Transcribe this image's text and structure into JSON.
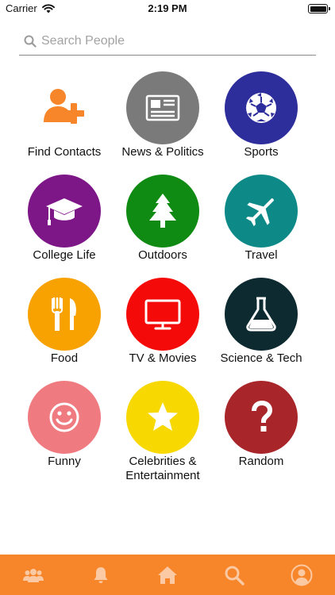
{
  "status_bar": {
    "carrier": "Carrier",
    "time": "2:19 PM",
    "icons": [
      "wifi-icon",
      "battery-icon"
    ]
  },
  "search": {
    "placeholder": "Search People",
    "value": "",
    "icon": "search-icon"
  },
  "categories": [
    {
      "label": "Find Contacts",
      "icon": "add-contact-icon",
      "color": "#f7852a"
    },
    {
      "label": "News & Politics",
      "icon": "newspaper-icon",
      "color": "#7a7a7a"
    },
    {
      "label": "Sports",
      "icon": "soccer-ball-icon",
      "color": "#2d2d9c"
    },
    {
      "label": "College Life",
      "icon": "graduation-cap-icon",
      "color": "#7d1687"
    },
    {
      "label": "Outdoors",
      "icon": "pine-tree-icon",
      "color": "#0f8a12"
    },
    {
      "label": "Travel",
      "icon": "airplane-icon",
      "color": "#0d8a88"
    },
    {
      "label": "Food",
      "icon": "fork-knife-icon",
      "color": "#f7a200"
    },
    {
      "label": "TV & Movies",
      "icon": "tv-icon",
      "color": "#f50a0a"
    },
    {
      "label": "Science & Tech",
      "icon": "flask-icon",
      "color": "#0d2a30"
    },
    {
      "label": "Funny",
      "icon": "smiley-icon",
      "color": "#ef7b80"
    },
    {
      "label": "Celebrities & Entertainment",
      "icon": "star-icon",
      "color": "#f7d800"
    },
    {
      "label": "Random",
      "icon": "question-icon",
      "color": "#a8252a"
    }
  ],
  "tab_bar": {
    "color": "#f7852a",
    "tabs": [
      {
        "icon": "people-icon"
      },
      {
        "icon": "bell-icon"
      },
      {
        "icon": "home-icon"
      },
      {
        "icon": "search-icon"
      },
      {
        "icon": "profile-icon"
      }
    ]
  }
}
